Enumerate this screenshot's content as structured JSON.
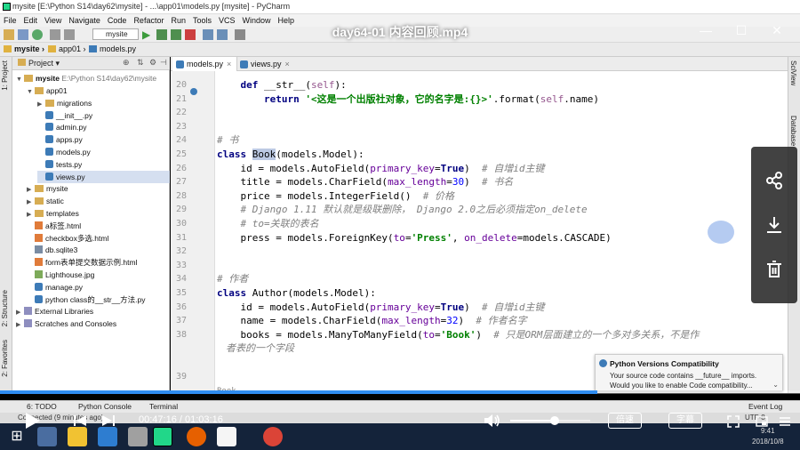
{
  "window": {
    "title": "mysite [E:\\Python S14\\day62\\mysite] - ...\\app01\\models.py [mysite] - PyCharm"
  },
  "menu": [
    "File",
    "Edit",
    "View",
    "Navigate",
    "Code",
    "Refactor",
    "Run",
    "Tools",
    "VCS",
    "Window",
    "Help"
  ],
  "toolbar": {
    "run_config": "mysite"
  },
  "breadcrumb": [
    "mysite",
    "app01",
    "models.py"
  ],
  "left_tools": [
    "1: Project",
    "2: Structure",
    "2: Favorites"
  ],
  "right_tools": [
    "SciView",
    "Database"
  ],
  "project_panel": {
    "title": "Project",
    "root": {
      "name": "mysite",
      "path": "E:\\Python S14\\day62\\mysite"
    },
    "items": [
      {
        "label": "app01",
        "type": "folder",
        "level": 1,
        "open": true
      },
      {
        "label": "migrations",
        "type": "folder",
        "level": 2,
        "open": false
      },
      {
        "label": "__init__.py",
        "type": "py",
        "level": 2
      },
      {
        "label": "admin.py",
        "type": "py",
        "level": 2
      },
      {
        "label": "apps.py",
        "type": "py",
        "level": 2
      },
      {
        "label": "models.py",
        "type": "py",
        "level": 2
      },
      {
        "label": "tests.py",
        "type": "py",
        "level": 2
      },
      {
        "label": "views.py",
        "type": "py",
        "level": 2,
        "selected": true
      },
      {
        "label": "mysite",
        "type": "folder",
        "level": 1,
        "open": false
      },
      {
        "label": "static",
        "type": "folder",
        "level": 1,
        "open": false
      },
      {
        "label": "templates",
        "type": "folder",
        "level": 1,
        "open": false
      },
      {
        "label": "a标签.html",
        "type": "html",
        "level": 1
      },
      {
        "label": "checkbox多选.html",
        "type": "html",
        "level": 1
      },
      {
        "label": "db.sqlite3",
        "type": "db",
        "level": 1
      },
      {
        "label": "form表单提交数据示例.html",
        "type": "html",
        "level": 1
      },
      {
        "label": "Lighthouse.jpg",
        "type": "img",
        "level": 1
      },
      {
        "label": "manage.py",
        "type": "py",
        "level": 1
      },
      {
        "label": "python class的__str__方法.py",
        "type": "py",
        "level": 1
      },
      {
        "label": "External Libraries",
        "type": "lib",
        "level": 0
      },
      {
        "label": "Scratches and Consoles",
        "type": "lib",
        "level": 0
      }
    ]
  },
  "tabs": [
    {
      "label": "models.py",
      "active": true
    },
    {
      "label": "views.py",
      "active": false
    }
  ],
  "code": [
    {
      "n": "20",
      "html": "    <span class=\"kw\">def</span> __str__(<span class=\"self\">self</span>):"
    },
    {
      "n": "21",
      "html": "        <span class=\"kw\">return</span> <span class=\"str\">'&lt;这是一个出版社对象，它的名字是:{}&gt;'</span>.format(<span class=\"self\">self</span>.name)"
    },
    {
      "n": "22",
      "html": ""
    },
    {
      "n": "23",
      "html": ""
    },
    {
      "n": "24",
      "html": "<span class=\"cm\"># 书</span>"
    },
    {
      "n": "25",
      "html": "<span class=\"kw\">class</span> <span class=\"hl\">Book</span>(models.Model):"
    },
    {
      "n": "26",
      "html": "    id = models.AutoField(<span class=\"pr\">primary_key</span>=<span class=\"kw\">True</span>)  <span class=\"cm\"># 自增id主键</span>"
    },
    {
      "n": "27",
      "html": "    title = models.CharField(<span class=\"pr\">max_length</span>=<span style=\"color:#0000ff\">30</span>)  <span class=\"cm\"># 书名</span>"
    },
    {
      "n": "28",
      "html": "    price = models.IntegerField()  <span class=\"cm\"># 价格</span>"
    },
    {
      "n": "29",
      "html": "    <span class=\"cm\"># Django 1.11 默认就是级联删除， Django 2.0之后必须指定on_delete</span>"
    },
    {
      "n": "30",
      "html": "    <span class=\"cm\"># to=关联的表名</span>"
    },
    {
      "n": "31",
      "html": "    press = models.ForeignKey(<span class=\"pr\">to</span>=<span class=\"str\">'Press'</span>, <span class=\"pr\">on_delete</span>=models.CASCADE)"
    },
    {
      "n": "32",
      "html": ""
    },
    {
      "n": "33",
      "html": ""
    },
    {
      "n": "34",
      "html": "<span class=\"cm\"># 作者</span>"
    },
    {
      "n": "35",
      "html": "<span class=\"kw\">class</span> Author(models.Model):"
    },
    {
      "n": "36",
      "html": "    id = models.AutoField(<span class=\"pr\">primary_key</span>=<span class=\"kw\">True</span>)  <span class=\"cm\"># 自增id主键</span>"
    },
    {
      "n": "37",
      "html": "    name = models.CharField(<span class=\"pr\">max_length</span>=<span style=\"color:#0000ff\">32</span>)  <span class=\"cm\"># 作者名字</span>"
    },
    {
      "n": "38",
      "html": "    books = models.ManyToManyField(<span class=\"pr\">to</span>=<span class=\"str\">'Book'</span>)  <span class=\"cm\"># 只是ORM层面建立的一个多对多关系，不是作</span>"
    },
    {
      "n": "",
      "html": "<span class=\"cm\">者表的一个字段</span>"
    },
    {
      "n": "",
      "html": ""
    },
    {
      "n": "39",
      "html": ""
    }
  ],
  "editor_footer": "Book",
  "popup": {
    "title": "Python Versions Compatibility",
    "line1": "Your source code contains __future__ imports.",
    "line2": "Would you like to enable Code compatibility..."
  },
  "bottom_tools": [
    "6: TODO",
    "Python Console",
    "Terminal",
    "Event Log"
  ],
  "status": {
    "left": "Connected (9 minutes ago)",
    "encoding": "UTF-8",
    "time": "9:41",
    "date": "2018/10/8"
  },
  "player": {
    "title": "day64-01 内容回顾.mp4",
    "time_current": "00:47:16",
    "time_total": "01:03:16",
    "time_display": "00:47:16 / 01:03:16",
    "progress": 0.747,
    "volume": 0.55,
    "speed_label": "倍速",
    "subtitle_label": "字幕"
  },
  "colors": {
    "accent": "#2f8cf0",
    "keyword": "#000080",
    "string": "#008000",
    "comment": "#808080"
  }
}
